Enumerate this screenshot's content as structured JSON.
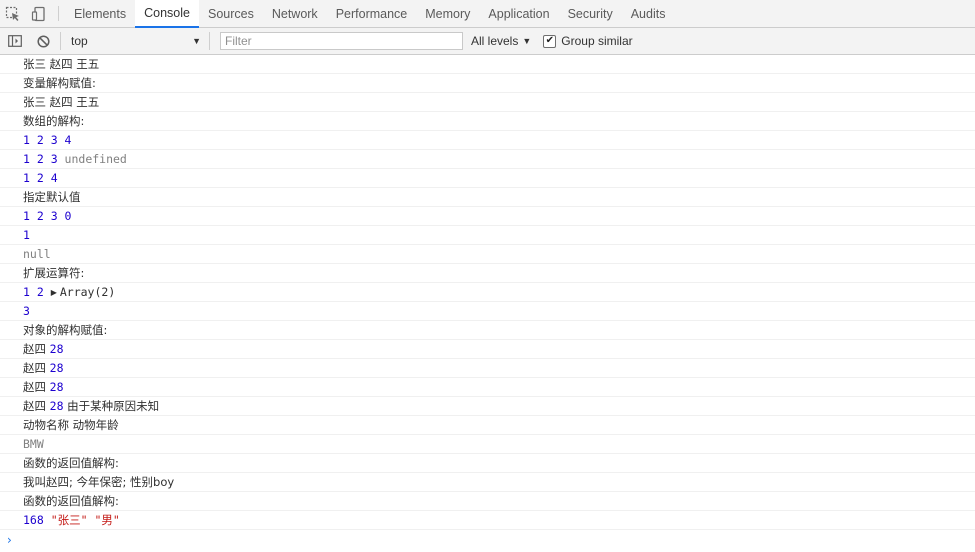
{
  "tabs": [
    "Elements",
    "Console",
    "Sources",
    "Network",
    "Performance",
    "Memory",
    "Application",
    "Security",
    "Audits"
  ],
  "active_tab": "Console",
  "toolbar": {
    "context": "top",
    "filter_placeholder": "Filter",
    "levels": "All levels",
    "group_similar": "Group similar",
    "group_similar_checked": true
  },
  "colors": {
    "accent": "#1a73e8",
    "number": "#1c00cf",
    "string": "#c41a16",
    "muted": "#808080"
  },
  "lines": [
    [
      {
        "t": "张三 赵四 王五",
        "c": "txt"
      }
    ],
    [
      {
        "t": "变量解构赋值:",
        "c": "txt"
      }
    ],
    [
      {
        "t": "张三 赵四 王五",
        "c": "txt"
      }
    ],
    [
      {
        "t": "数组的解构:",
        "c": "txt"
      }
    ],
    [
      {
        "t": "1 2 3 4",
        "c": "num"
      }
    ],
    [
      {
        "t": "1 2 3 ",
        "c": "num"
      },
      {
        "t": "undefined",
        "c": "gray"
      }
    ],
    [
      {
        "t": "1 2 4",
        "c": "num"
      }
    ],
    [
      {
        "t": "指定默认值",
        "c": "txt"
      }
    ],
    [
      {
        "t": "1 2 3 0",
        "c": "num"
      }
    ],
    [
      {
        "t": "1",
        "c": "num"
      }
    ],
    [
      {
        "t": "null",
        "c": "gray"
      }
    ],
    [
      {
        "t": "扩展运算符:",
        "c": "txt"
      }
    ],
    [
      {
        "t": "1 2 ",
        "c": "num"
      },
      {
        "t": "▶",
        "c": "tri"
      },
      {
        "t": "Array(2)",
        "c": "mono"
      }
    ],
    [
      {
        "t": "3",
        "c": "num"
      }
    ],
    [
      {
        "t": "对象的解构赋值:",
        "c": "txt"
      }
    ],
    [
      {
        "t": "赵四 ",
        "c": "txt"
      },
      {
        "t": "28",
        "c": "num"
      }
    ],
    [
      {
        "t": "赵四 ",
        "c": "txt"
      },
      {
        "t": "28",
        "c": "num"
      }
    ],
    [
      {
        "t": "赵四 ",
        "c": "txt"
      },
      {
        "t": "28",
        "c": "num"
      }
    ],
    [
      {
        "t": "赵四 ",
        "c": "txt"
      },
      {
        "t": "28",
        "c": "num"
      },
      {
        "t": " 由于某种原因未知",
        "c": "txt"
      }
    ],
    [
      {
        "t": "动物名称 动物年龄",
        "c": "txt"
      }
    ],
    [
      {
        "t": "BMW",
        "c": "gray"
      }
    ],
    [
      {
        "t": "函数的返回值解构:",
        "c": "txt"
      }
    ],
    [
      {
        "t": "我叫赵四; 今年保密; 性别boy",
        "c": "txt"
      }
    ],
    [
      {
        "t": "函数的返回值解构:",
        "c": "txt"
      }
    ],
    [
      {
        "t": "168 ",
        "c": "num"
      },
      {
        "t": "\"张三\" \"男\"",
        "c": "str"
      }
    ]
  ]
}
